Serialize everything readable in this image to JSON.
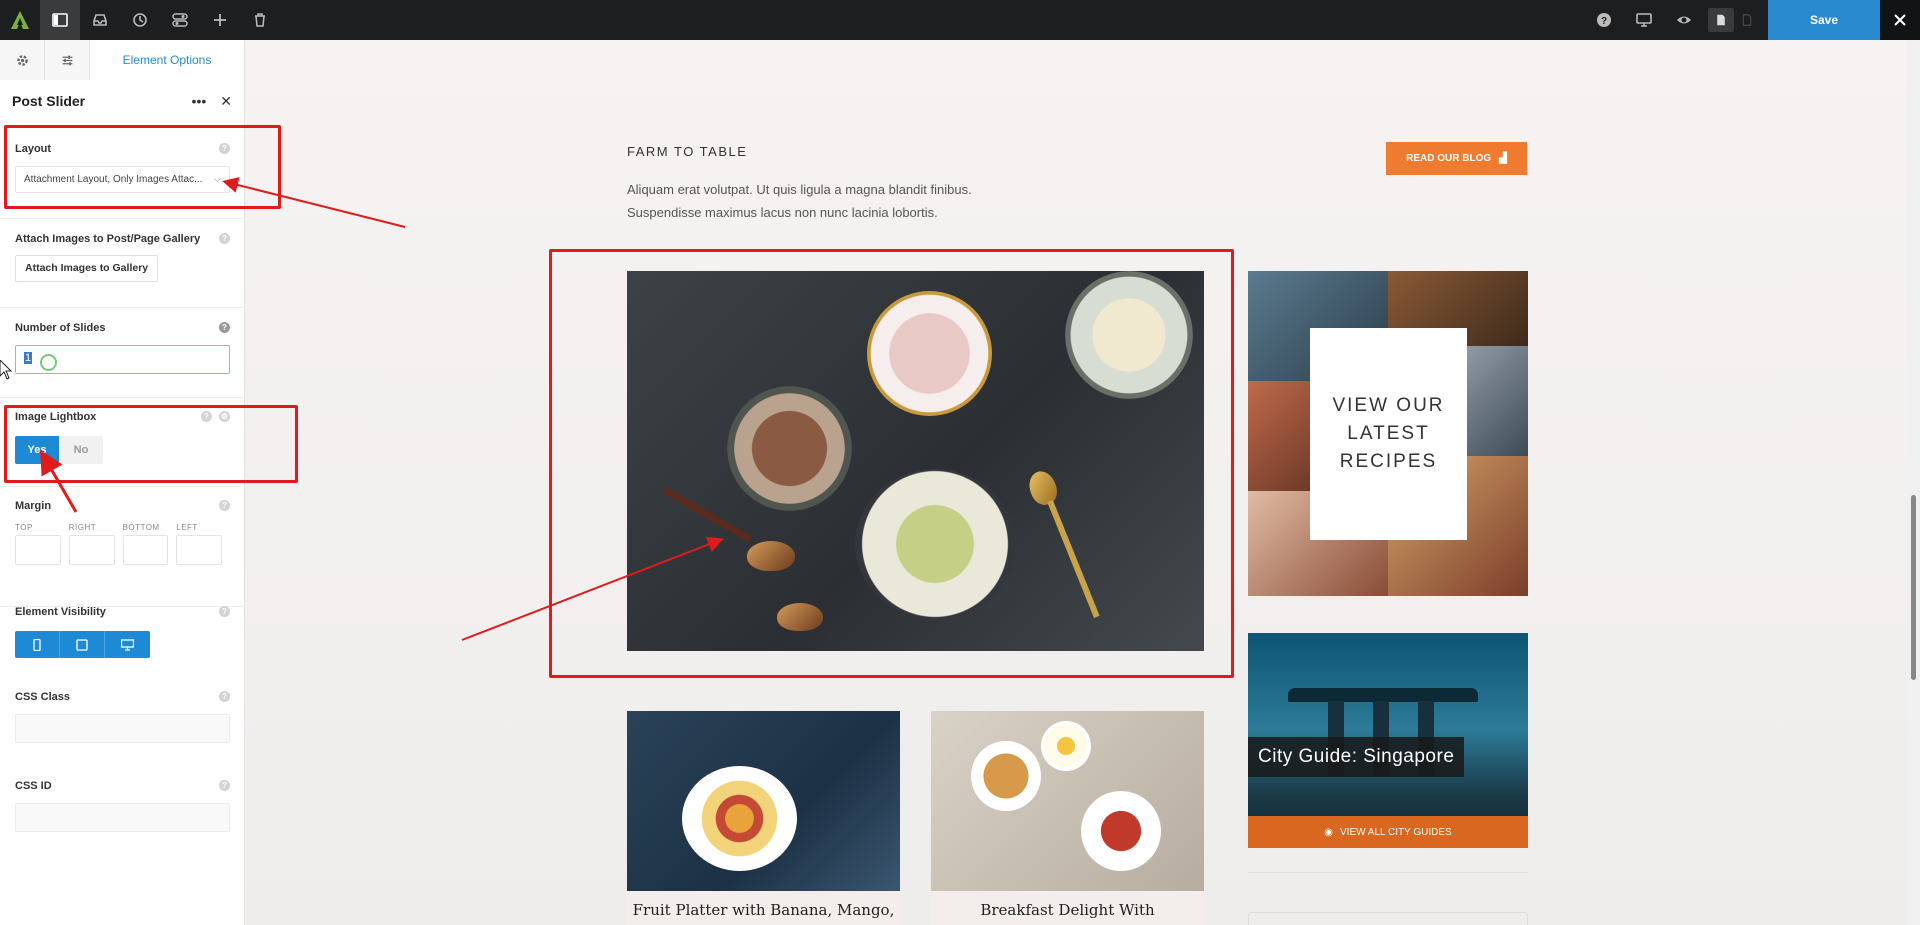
{
  "toolbar": {
    "save_label": "Save",
    "icons": [
      "logo",
      "layout-icon",
      "inbox-icon",
      "history-icon",
      "toggle-icon",
      "plus-icon",
      "trash-icon",
      "help-icon",
      "desktop-icon",
      "eye-icon",
      "page-icon",
      "page-alt-icon",
      "close-icon"
    ]
  },
  "sidebar": {
    "tabs": {
      "settings_icon": "gear-icon",
      "sliders_icon": "sliders-icon",
      "element_options": "Element Options"
    },
    "panel_title": "Post Slider",
    "layout": {
      "label": "Layout",
      "value": "Attachment Layout, Only Images Attac..."
    },
    "attach": {
      "label": "Attach Images to Post/Page Gallery",
      "button": "Attach Images to Gallery"
    },
    "slides": {
      "label": "Number of Slides",
      "value": "1"
    },
    "lightbox": {
      "label": "Image Lightbox",
      "yes": "Yes",
      "no": "No",
      "selected": "Yes"
    },
    "margin": {
      "label": "Margin",
      "top": "TOP",
      "right": "RIGHT",
      "bottom": "BOTTOM",
      "left": "LEFT"
    },
    "visibility": {
      "label": "Element Visibility"
    },
    "css_class": {
      "label": "CSS Class"
    },
    "css_id": {
      "label": "CSS ID"
    }
  },
  "page": {
    "eyebrow": "FARM TO TABLE",
    "intro": "Aliquam erat volutpat. Ut quis ligula a magna blandit finibus. Suspendisse maximus lacus non nunc lacinia lobortis.",
    "blog_button": "READ OUR BLOG",
    "recipes_card": "VIEW OUR LATEST RECIPES",
    "city_card": {
      "title": "City Guide: Singapore",
      "button": "VIEW ALL CITY GUIDES"
    },
    "posts": [
      {
        "caption": "Fruit Platter with Banana, Mango,"
      },
      {
        "caption": "Breakfast Delight With"
      }
    ]
  },
  "colors": {
    "accent": "#1e8ad6",
    "orange": "#ee7b2f",
    "annotation": "#e01b1b",
    "toolbar": "#1d1e20"
  }
}
